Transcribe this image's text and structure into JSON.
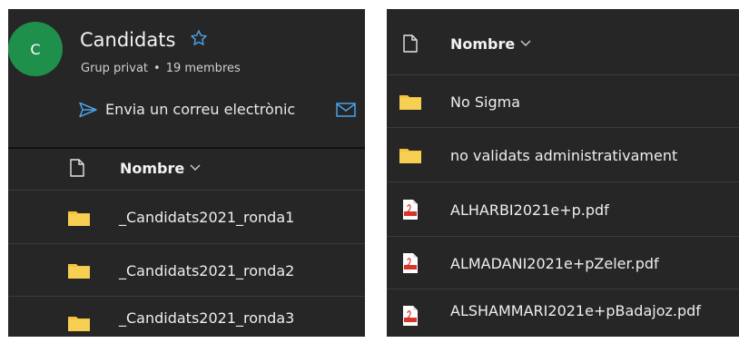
{
  "group": {
    "avatar_letter": "C",
    "title": "Candidats",
    "type": "Grup privat",
    "separator": "•",
    "members": "19 membres",
    "email_action": "Envia un correu electrònic"
  },
  "left_list": {
    "column_header": "Nombre",
    "items": [
      {
        "name": "_Candidats2021_ronda1",
        "icon": "folder-icon"
      },
      {
        "name": "_Candidats2021_ronda2",
        "icon": "folder-icon"
      },
      {
        "name": "_Candidats2021_ronda3",
        "icon": "folder-icon"
      }
    ]
  },
  "right_list": {
    "column_header": "Nombre",
    "items": [
      {
        "name": "No Sigma",
        "icon": "folder-icon"
      },
      {
        "name": "no validats administrativament",
        "icon": "folder-icon"
      },
      {
        "name": "ALHARBI2021e+p.pdf",
        "icon": "pdf-icon"
      },
      {
        "name": "ALMADANI2021e+pZeler.pdf",
        "icon": "pdf-icon"
      },
      {
        "name": "ALSHAMMARI2021e+pBadajoz.pdf",
        "icon": "pdf-icon"
      }
    ]
  },
  "colors": {
    "background": "#262626",
    "avatar": "#1f8f4c",
    "accent": "#4aa0e6",
    "folder": "#f3c33f",
    "pdf": "#d9342b"
  }
}
